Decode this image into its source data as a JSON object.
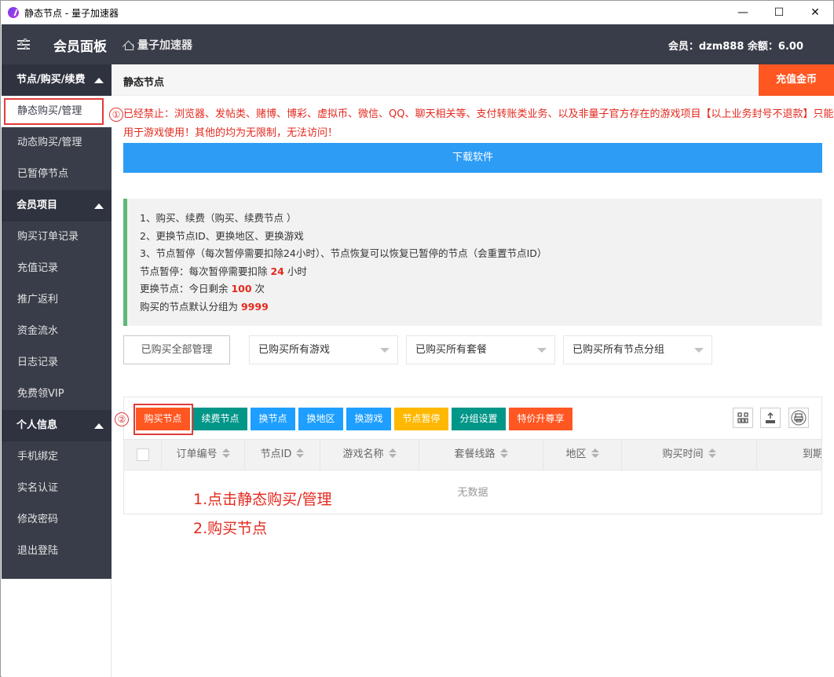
{
  "window": {
    "title": "静态节点 - 量子加速器",
    "controls": {
      "minimize": "—",
      "maximize": "☐",
      "close": "✕"
    }
  },
  "header": {
    "panel_title": "会员面板",
    "home_label": "量子加速器",
    "member_info": "会员：dzm888 余额：6.00"
  },
  "sidebar": {
    "groups": [
      {
        "label": "节点/购买/续费",
        "items": [
          "静态购买/管理",
          "动态购买/管理",
          "已暂停节点"
        ]
      },
      {
        "label": "会员项目",
        "items": [
          "购买订单记录",
          "充值记录",
          "推广返利",
          "资金流水",
          "日志记录",
          "免费领VIP"
        ]
      },
      {
        "label": "个人信息",
        "items": [
          "手机绑定",
          "实名认证",
          "修改密码",
          "退出登陆"
        ]
      }
    ],
    "active_item": "静态购买/管理"
  },
  "main": {
    "page_title": "静态节点",
    "recharge_button": "充值金币",
    "notice": "已经禁止：浏览器、发帖类、赌博、博彩、虚拟币、微信、QQ、聊天相关等、支付转账类业务、以及非量子官方存在的游戏项目【以上业务封号不退款】只能用于游戏使用！其他的均为无限制，无法访问！",
    "download_button": "下载软件",
    "info_lines": [
      "1、购买、续费（购买、续费节点 ）",
      "2、更换节点ID、更换地区、更换游戏",
      "3、节点暂停（每次暂停需要扣除24小时）、节点恢复可以恢复已暂停的节点（会重置节点ID）"
    ],
    "pause_text": {
      "prefix": "节点暂停：每次暂停需要扣除 ",
      "value": "24",
      "suffix": " 小时"
    },
    "change_text": {
      "prefix": "更换节点：今日剩余 ",
      "value": "100",
      "suffix": " 次"
    },
    "group_text": {
      "prefix": "购买的节点默认分组为 ",
      "value": "9999"
    },
    "filters": {
      "manage_all": "已购买全部管理",
      "games": "已购买所有游戏",
      "packages": "已购买所有套餐",
      "groups": "已购买所有节点分组"
    },
    "toolbar": [
      "购买节点",
      "续费节点",
      "换节点",
      "换地区",
      "换游戏",
      "节点暂停",
      "分组设置",
      "特价升尊享"
    ],
    "toolbar_icons": [
      "columns-icon",
      "export-icon",
      "print-icon"
    ],
    "table": {
      "columns": [
        "订单编号",
        "节点ID",
        "游戏名称",
        "套餐线路",
        "地区",
        "购买时间",
        "到期"
      ],
      "empty_text": "无数据"
    }
  },
  "annotations": {
    "circle_1": "①",
    "circle_2": "②",
    "step1": "1.点击静态购买/管理",
    "step2": "2.购买节点"
  },
  "colors": {
    "sidebar_bg": "#393d49",
    "accent_orange": "#ff5722",
    "teal": "#009688",
    "blue": "#1e9fff",
    "yellow": "#ffb800",
    "download_blue": "#2d9cf5",
    "info_border": "#5fb878",
    "highlight_red": "#e3291e"
  }
}
